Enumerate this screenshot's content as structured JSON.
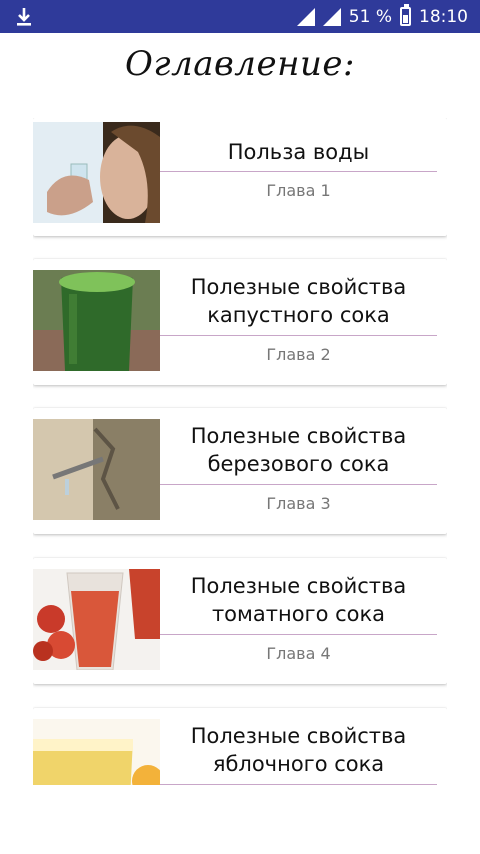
{
  "status_bar": {
    "battery": "51 %",
    "battery_level": 0.51,
    "time": "18:10",
    "icons": [
      "download-icon",
      "signal-icon",
      "battery-icon"
    ]
  },
  "page": {
    "title": "Оглавление:"
  },
  "chapters": [
    {
      "title_lines": [
        "Польза воды"
      ],
      "subtitle": "Глава 1",
      "image": "woman-drinking-water-image"
    },
    {
      "title_lines": [
        "Полезные свойства",
        "капустного сока"
      ],
      "subtitle": "Глава 2",
      "image": "cabbage-juice-glass-image"
    },
    {
      "title_lines": [
        "Полезные свойства",
        "березового сока"
      ],
      "subtitle": "Глава 3",
      "image": "birch-sap-tap-image"
    },
    {
      "title_lines": [
        "Полезные свойства",
        "томатного сока"
      ],
      "subtitle": "Глава 4",
      "image": "tomato-juice-glasses-image"
    },
    {
      "title_lines": [
        "Полезные свойства",
        "яблочного сока"
      ],
      "subtitle": "",
      "image": "apple-juice-glass-image"
    }
  ]
}
